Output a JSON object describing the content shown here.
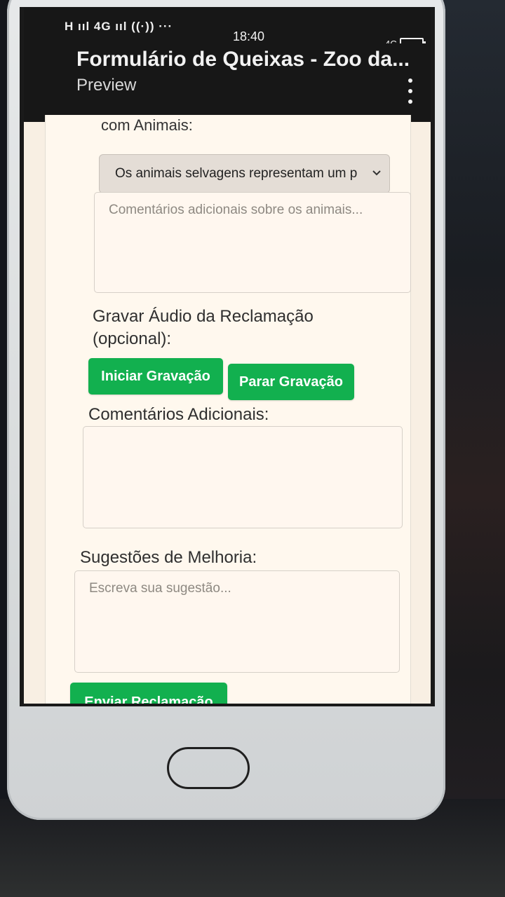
{
  "status_bar": {
    "signal": "H ııl 4G ııl ((·)) ···",
    "time": "18:40",
    "network": "4G"
  },
  "app_bar": {
    "title": "Formulário de Queixas - Zoo da...",
    "subtitle": "Preview"
  },
  "form": {
    "animals": {
      "label_partial": "com Animais:",
      "selected_option": "Os animais selvagens representam um p",
      "comments_placeholder": "Comentários adicionais sobre os animais..."
    },
    "audio": {
      "label": "Gravar Áudio da Reclamação (opcional):",
      "start_label": "Iniciar Gravação",
      "stop_label": "Parar Gravação"
    },
    "comments": {
      "label": "Comentários Adicionais:",
      "placeholder": ""
    },
    "suggestions": {
      "label": "Sugestões de Melhoria:",
      "placeholder": "Escreva sua sugestão..."
    },
    "submit_label": "Enviar Reclamação"
  },
  "colors": {
    "accent_green": "#12b04f",
    "app_bar": "#171717",
    "screen_bg": "#fff8ee"
  }
}
